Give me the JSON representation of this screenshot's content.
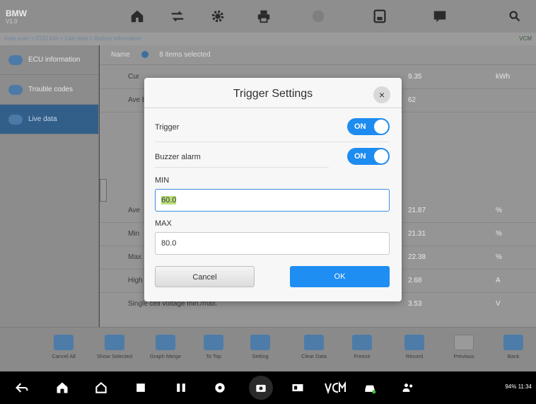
{
  "brand": {
    "name": "BMW",
    "sub": "V1.0"
  },
  "topbar": {
    "icons": [
      "home-icon",
      "vehicle-swap-icon",
      "gear-icon",
      "print-icon",
      "help-icon",
      "save-icon",
      "message-icon",
      "search-icon"
    ]
  },
  "subbar": {
    "path": "Auto scan > ECU info > Live data > Battery information",
    "right": "VCM"
  },
  "sidebar": {
    "items": [
      {
        "label": "ECU information"
      },
      {
        "label": "Trouble codes"
      },
      {
        "label": "Live data"
      }
    ]
  },
  "list": {
    "header_left": "Name",
    "header_selected": "8 items selected",
    "rows": [
      {
        "label": "Cur",
        "value": "9.35",
        "unit": "kWh"
      },
      {
        "label": "Ave batt",
        "value": "62",
        "unit": ""
      },
      {
        "label": "Ave",
        "value": "21.87",
        "unit": "%"
      },
      {
        "label": "Min",
        "value": "21.31",
        "unit": "%"
      },
      {
        "label": "Max",
        "value": "22.38",
        "unit": "%"
      },
      {
        "label": "High",
        "value": "2.68",
        "unit": "A"
      },
      {
        "label": "Single cell voltage min./max.",
        "value": "3.53",
        "unit": "V"
      }
    ]
  },
  "actions": [
    {
      "label": "Cancel All"
    },
    {
      "label": "Show Selected"
    },
    {
      "label": "Graph Merge"
    },
    {
      "label": "To Top"
    },
    {
      "label": "Setting"
    },
    {
      "label": "Clear Data"
    },
    {
      "label": "Freeze"
    },
    {
      "label": "Record"
    },
    {
      "label": "Previous"
    },
    {
      "label": "Back"
    }
  ],
  "status": {
    "text": "94% 11:34"
  },
  "dialog": {
    "title": "Trigger Settings",
    "close": "×",
    "trigger_label": "Trigger",
    "trigger_state": "ON",
    "buzzer_label": "Buzzer alarm",
    "buzzer_state": "ON",
    "min_label": "MIN",
    "min_value": "60.0",
    "max_label": "MAX",
    "max_value": "80.0",
    "cancel_label": "Cancel",
    "ok_label": "OK"
  },
  "colors": {
    "accent": "#1f8ef2",
    "toggle_on": "#1d8cf0",
    "selection": "#b9e07a"
  }
}
